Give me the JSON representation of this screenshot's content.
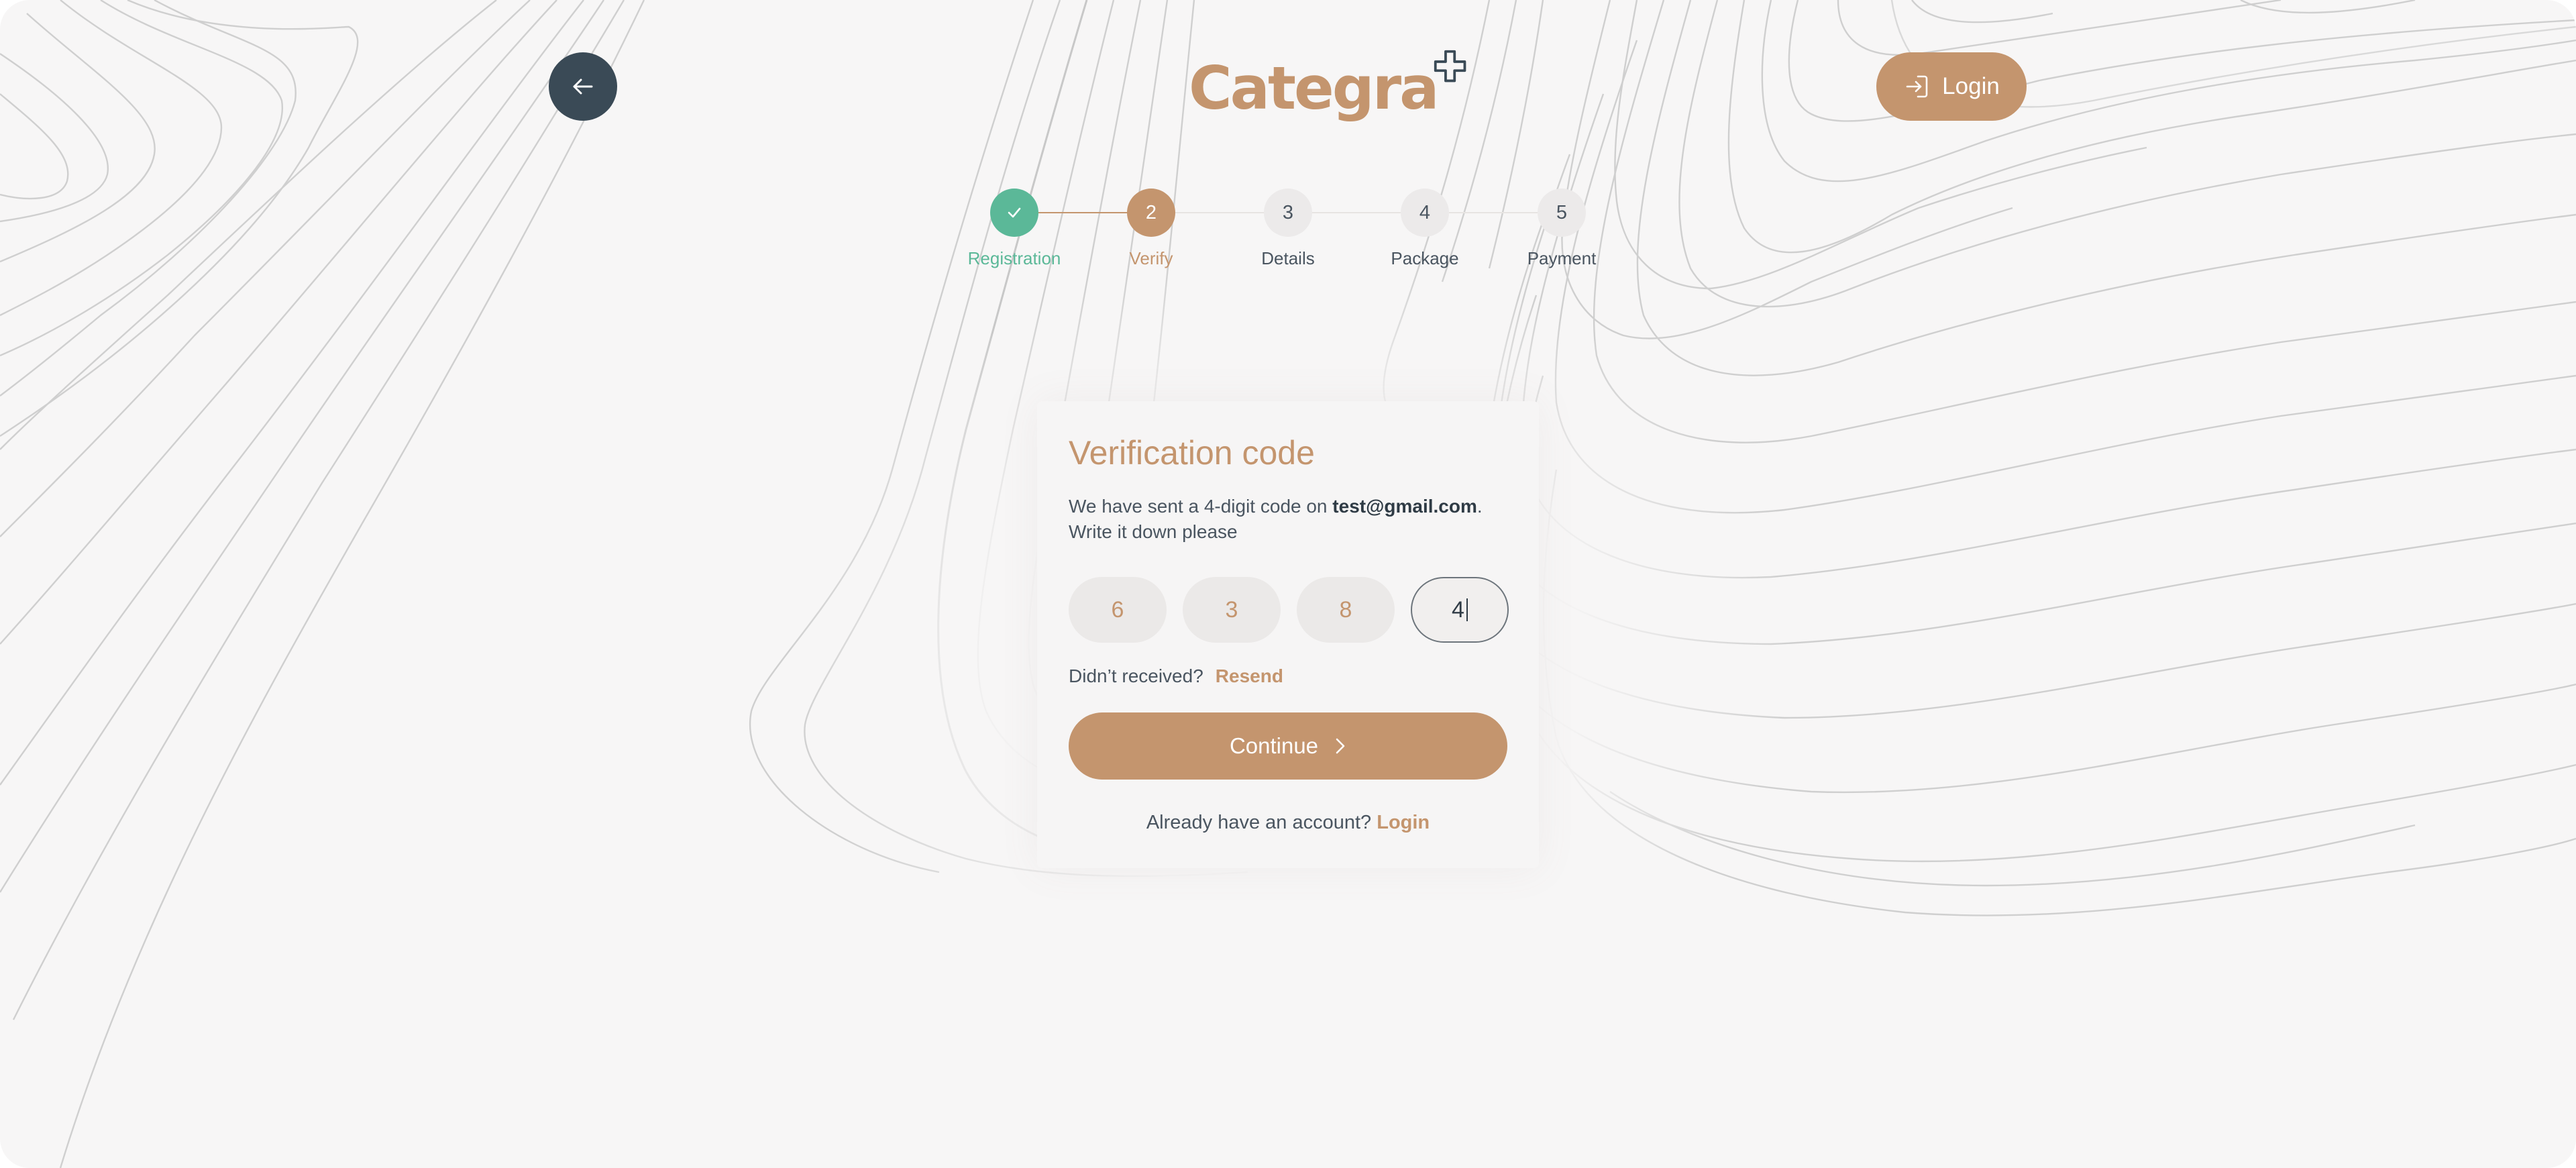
{
  "header": {
    "back_icon": "arrow-left-icon",
    "logo_text": "Categra",
    "login_label": "Login",
    "login_icon": "sign-in-icon"
  },
  "stepper": {
    "steps": [
      {
        "number": "✓",
        "label": "Registration",
        "state": "done"
      },
      {
        "number": "2",
        "label": "Verify",
        "state": "current"
      },
      {
        "number": "3",
        "label": "Details",
        "state": "pending"
      },
      {
        "number": "4",
        "label": "Package",
        "state": "pending"
      },
      {
        "number": "5",
        "label": "Payment",
        "state": "pending"
      }
    ]
  },
  "card": {
    "title": "Verification code",
    "desc_prefix": "We have sent a 4-digit code on ",
    "email": "test@gmail.com",
    "desc_suffix": ".",
    "desc_line2": "Write it down please",
    "code_digits": [
      "6",
      "3",
      "8",
      "4"
    ],
    "resend_prompt": "Didn’t received?",
    "resend_label": "Resend",
    "continue_label": "Continue",
    "account_prompt": "Already have an account?",
    "account_login": "Login"
  },
  "colors": {
    "accent": "#c4956e",
    "success": "#5bb898",
    "dark": "#3a4a56",
    "background": "#f7f6f6"
  }
}
